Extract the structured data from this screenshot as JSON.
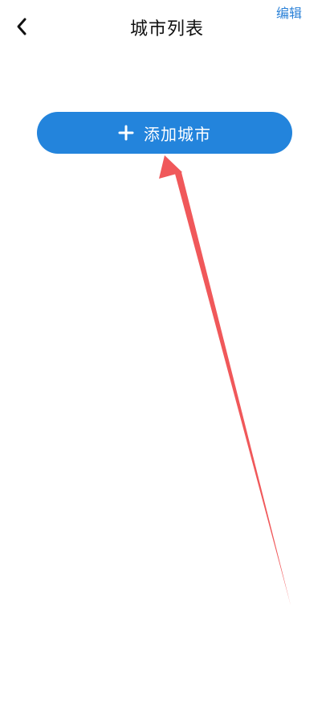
{
  "header": {
    "title": "城市列表",
    "edit_label": "编辑",
    "back_icon": "chevron-left-icon"
  },
  "main": {
    "add_city_label": "添加城市",
    "add_icon": "plus-icon"
  },
  "colors": {
    "accent": "#2384dc",
    "edit_text": "#2c82d8",
    "annotation_arrow": "#f0585a",
    "background": "#ffffff"
  }
}
